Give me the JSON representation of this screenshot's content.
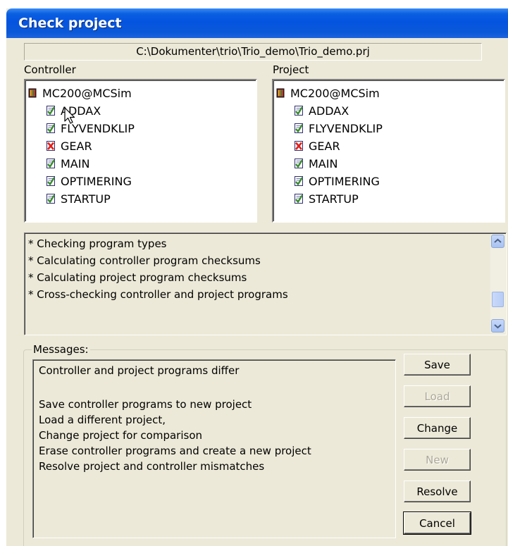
{
  "window": {
    "title": "Check project",
    "project_path": "C:\\Dokumenter\\trio\\Trio_demo\\Trio_demo.prj"
  },
  "controller": {
    "label": "Controller",
    "root": {
      "text": "MC200@MCSim",
      "icon": "controller-icon"
    },
    "items": [
      {
        "text": "ADDAX",
        "status": "ok"
      },
      {
        "text": "FLYVENDKLIP",
        "status": "ok"
      },
      {
        "text": "GEAR",
        "status": "error"
      },
      {
        "text": "MAIN",
        "status": "ok"
      },
      {
        "text": "OPTIMERING",
        "status": "ok"
      },
      {
        "text": "STARTUP",
        "status": "ok"
      }
    ]
  },
  "project": {
    "label": "Project",
    "root": {
      "text": "MC200@MCSim",
      "icon": "controller-icon"
    },
    "items": [
      {
        "text": "ADDAX",
        "status": "ok"
      },
      {
        "text": "FLYVENDKLIP",
        "status": "ok"
      },
      {
        "text": "GEAR",
        "status": "error"
      },
      {
        "text": "MAIN",
        "status": "ok"
      },
      {
        "text": "OPTIMERING",
        "status": "ok"
      },
      {
        "text": "STARTUP",
        "status": "ok"
      }
    ]
  },
  "log": {
    "lines": [
      "* Checking program types",
      "* Calculating controller program checksums",
      "* Calculating project program checksums",
      "* Cross-checking controller and project programs"
    ]
  },
  "messages": {
    "legend": "Messages:",
    "lines": [
      "Controller and project programs differ",
      "",
      "Save controller programs to new project",
      "Load a different project,",
      "Change project for comparison",
      "Erase controller programs and create a new project",
      "Resolve project and controller mismatches"
    ]
  },
  "buttons": {
    "save": "Save",
    "load": "Load",
    "change": "Change",
    "new": "New",
    "resolve": "Resolve",
    "cancel": "Cancel"
  },
  "colors": {
    "titlebar": "#0554e0",
    "ok_icon": "#3a8a2e",
    "error_icon": "#e02020",
    "face": "#ece9d8"
  }
}
